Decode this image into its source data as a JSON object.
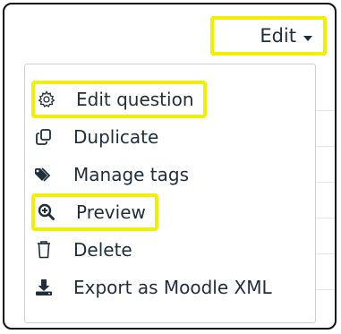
{
  "edit_button": {
    "label": "Edit",
    "caret_icon": "caret-down-icon"
  },
  "menu": {
    "items": [
      {
        "label": "Edit question",
        "icon": "gear-icon"
      },
      {
        "label": "Duplicate",
        "icon": "copy-icon"
      },
      {
        "label": "Manage tags",
        "icon": "tag-icon"
      },
      {
        "label": "Preview",
        "icon": "search-plus-icon"
      },
      {
        "label": "Delete",
        "icon": "trash-icon"
      },
      {
        "label": "Export as Moodle XML",
        "icon": "download-icon"
      }
    ]
  },
  "colors": {
    "highlight": "#f2f000",
    "text": "#1f2d3d",
    "border": "#111111"
  }
}
